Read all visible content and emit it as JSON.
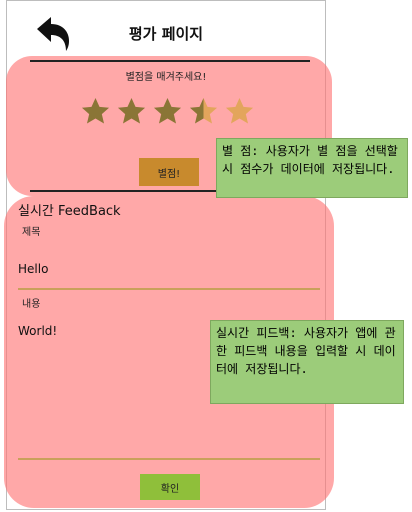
{
  "header": {
    "title": "평가 페이지"
  },
  "rating": {
    "prompt": "별점을 매겨주세요!",
    "value": 3.5,
    "max": 5,
    "button_label": "별점!"
  },
  "feedback": {
    "section_title": "실시간 FeedBack",
    "title_label": "제목",
    "title_value": "Hello",
    "content_label": "내용",
    "content_value": "World!",
    "confirm_label": "확인"
  },
  "annotations": [
    {
      "text": "별 점: 사용자가 별 점을 선택할 시 점수가 데이터에 저장됩니다."
    },
    {
      "text": "실시간 피드백: 사용자가 앱에 관한 피드백 내용을 입력할 시 데이터에 저장됩니다."
    }
  ],
  "colors": {
    "overlay": "#ff7373",
    "star_filled": "#8a7536",
    "star_empty": "#e3a55c",
    "rate_button": "#c88a2d",
    "confirm_button": "#8fbf3a",
    "note_background": "#9ccc7a"
  },
  "icons": {
    "back": "back-arrow-icon",
    "star": "star-icon"
  }
}
